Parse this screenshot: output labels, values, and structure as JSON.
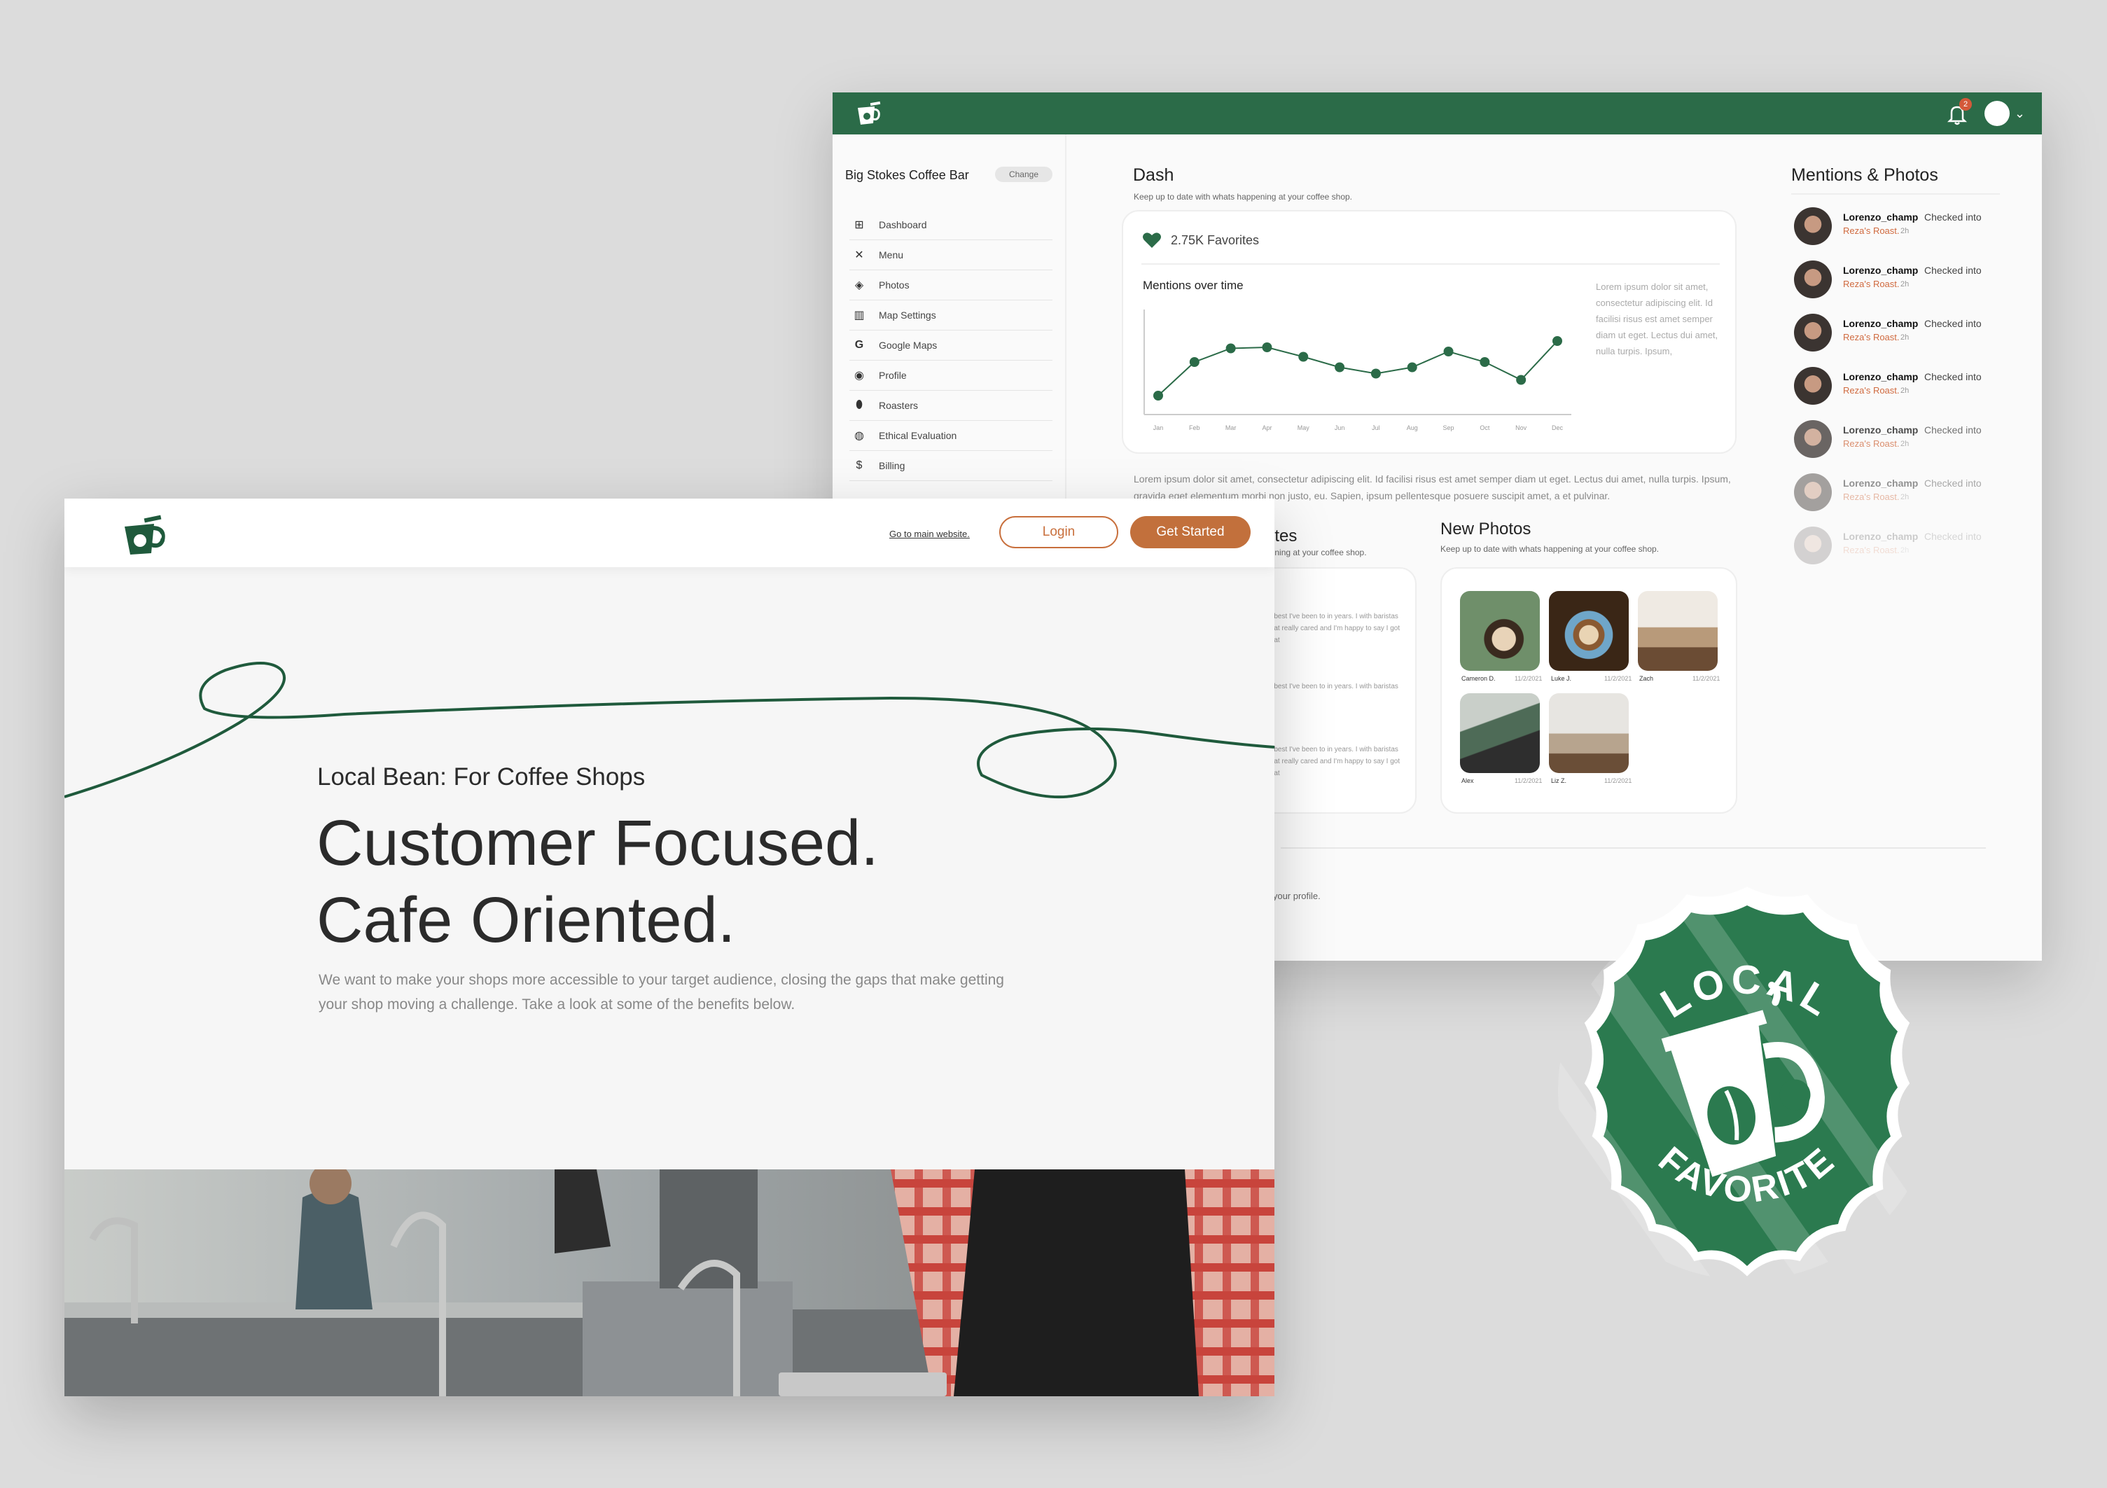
{
  "colors": {
    "brand_green": "#2b6b48",
    "accent_orange": "#c2703c",
    "background": "#dcdcdc"
  },
  "dashboard": {
    "header": {
      "notification_count": "2"
    },
    "sidebar": {
      "shop_name": "Big Stokes Coffee Bar",
      "change_label": "Change",
      "items": [
        {
          "label": "Dashboard",
          "icon": "dashboard-icon"
        },
        {
          "label": "Menu",
          "icon": "utensils-icon"
        },
        {
          "label": "Photos",
          "icon": "photos-icon"
        },
        {
          "label": "Map Settings",
          "icon": "map-icon"
        },
        {
          "label": "Google Maps",
          "icon": "google-icon"
        },
        {
          "label": "Profile",
          "icon": "profile-icon"
        },
        {
          "label": "Roasters",
          "icon": "bean-icon"
        },
        {
          "label": "Ethical Evaluation",
          "icon": "globe-icon"
        },
        {
          "label": "Billing",
          "icon": "billing-icon"
        }
      ]
    },
    "dash": {
      "title": "Dash",
      "subtitle": "Keep up to date with whats happening at your coffee shop.",
      "favorites": "2.75K Favorites",
      "chart_title": "Mentions over time",
      "card_text": "Lorem ipsum dolor sit amet, consectetur adipiscing elit. Id facilisi risus est amet semper diam ut eget. Lectus dui amet, nulla turpis. Ipsum,",
      "paragraph": "Lorem ipsum dolor sit amet, consectetur adipiscing elit. Id facilisi risus est amet semper diam ut eget. Lectus dui amet, nulla turpis. Ipsum, gravida eget elementum morbi non justo, eu. Sapien, ipsum pellentesque posuere suscipit amet, a et pulvinar."
    },
    "chart_data": {
      "type": "line",
      "categories": [
        "Jan",
        "Feb",
        "Mar",
        "Apr",
        "May",
        "Jun",
        "Jul",
        "Aug",
        "Sep",
        "Oct",
        "Nov",
        "Dec"
      ],
      "values": [
        18,
        50,
        63,
        64,
        55,
        45,
        39,
        45,
        60,
        50,
        33,
        70
      ],
      "title": "Mentions over time",
      "ylim": [
        0,
        100
      ],
      "grid": false
    },
    "notes": {
      "title": "otes",
      "subtitle": "pening at your coffee shop.",
      "items": [
        "e best I've been to in years. I with baristas that really cared and I'm happy to say I got that",
        "e best I've been to in years. I with baristas",
        "e best I've been to in years. I with baristas that really cared and I'm happy to say I got that"
      ]
    },
    "new_photos": {
      "title": "New Photos",
      "subtitle": "Keep up to date with whats happening at your coffee shop.",
      "photos": [
        {
          "name": "Cameron D.",
          "date": "11/2/2021"
        },
        {
          "name": "Luke J.",
          "date": "11/2/2021"
        },
        {
          "name": "Zach",
          "date": "11/2/2021"
        },
        {
          "name": "Alex",
          "date": "11/2/2021"
        },
        {
          "name": "Liz Z.",
          "date": "11/2/2021"
        }
      ]
    },
    "profile_text": "n your profile.",
    "mentions": {
      "title": "Mentions & Photos",
      "items": [
        {
          "user": "Lorenzo_champ",
          "action": "Checked into",
          "place": "Reza's Roast.",
          "time": "2h"
        },
        {
          "user": "Lorenzo_champ",
          "action": "Checked into",
          "place": "Reza's Roast.",
          "time": "2h"
        },
        {
          "user": "Lorenzo_champ",
          "action": "Checked into",
          "place": "Reza's Roast.",
          "time": "2h"
        },
        {
          "user": "Lorenzo_champ",
          "action": "Checked into",
          "place": "Reza's Roast.",
          "time": "2h"
        },
        {
          "user": "Lorenzo_champ",
          "action": "Checked into",
          "place": "Reza's Roast.",
          "time": "2h"
        },
        {
          "user": "Lorenzo_champ",
          "action": "Checked into",
          "place": "Reza's Roast.",
          "time": "2h"
        },
        {
          "user": "Lorenzo_champ",
          "action": "Checked into",
          "place": "Reza's Roast.",
          "time": "2h"
        }
      ]
    }
  },
  "landing": {
    "nav": {
      "go_main": "Go to main website.",
      "login": "Login",
      "get_started": "Get Started"
    },
    "hero": {
      "eyebrow": "Local Bean: For Coffee Shops",
      "line1": "Customer Focused.",
      "line2": "Cafe Oriented.",
      "body": "We want to make your shops more accessible to your target audience, closing the gaps that make getting your shop moving a challenge. Take a look at some of the benefits below."
    }
  },
  "badge": {
    "top": "LOCAL",
    "bottom": "FAVORITE"
  }
}
